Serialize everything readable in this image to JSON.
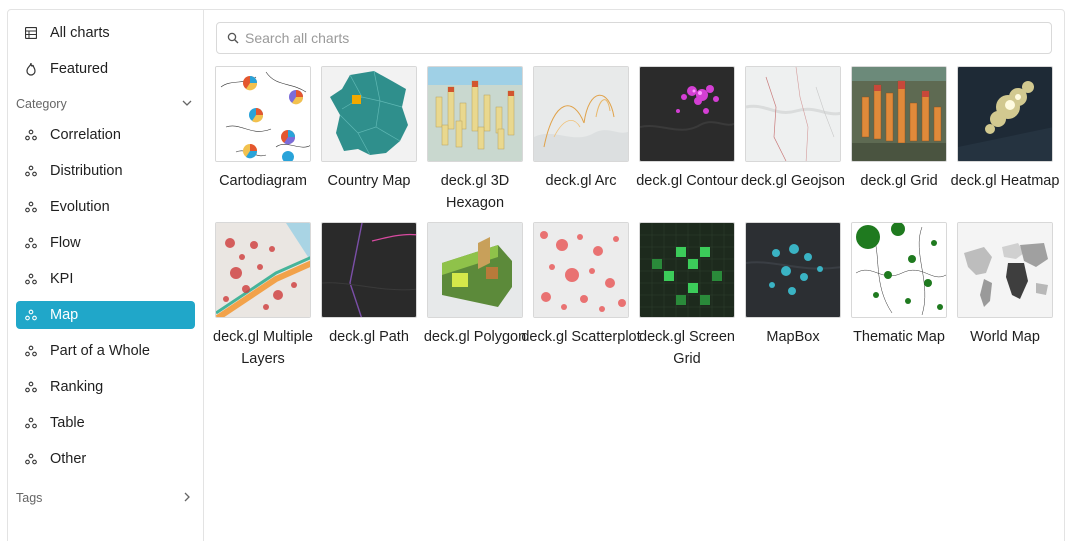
{
  "sidebar": {
    "all_charts": "All charts",
    "featured": "Featured",
    "category_header": "Category",
    "categories": [
      "Correlation",
      "Distribution",
      "Evolution",
      "Flow",
      "KPI",
      "Map",
      "Part of a Whole",
      "Ranking",
      "Table",
      "Other"
    ],
    "selected_category": "Map",
    "tags_header": "Tags"
  },
  "search": {
    "placeholder": "Search all charts",
    "value": ""
  },
  "charts": [
    {
      "label": "Cartodiagram",
      "thumb": "cartodiagram"
    },
    {
      "label": "Country Map",
      "thumb": "country-map"
    },
    {
      "label": "deck.gl 3D Hexagon",
      "thumb": "deckgl-3d-hexagon"
    },
    {
      "label": "deck.gl Arc",
      "thumb": "deckgl-arc"
    },
    {
      "label": "deck.gl Contour",
      "thumb": "deckgl-contour"
    },
    {
      "label": "deck.gl Geojson",
      "thumb": "deckgl-geojson"
    },
    {
      "label": "deck.gl Grid",
      "thumb": "deckgl-grid"
    },
    {
      "label": "deck.gl Heatmap",
      "thumb": "deckgl-heatmap"
    },
    {
      "label": "deck.gl Multiple Layers",
      "thumb": "deckgl-multiple-layers"
    },
    {
      "label": "deck.gl Path",
      "thumb": "deckgl-path"
    },
    {
      "label": "deck.gl Polygon",
      "thumb": "deckgl-polygon"
    },
    {
      "label": "deck.gl Scatterplot",
      "thumb": "deckgl-scatterplot"
    },
    {
      "label": "deck.gl Screen Grid",
      "thumb": "deckgl-screen-grid"
    },
    {
      "label": "MapBox",
      "thumb": "mapbox"
    },
    {
      "label": "Thematic Map",
      "thumb": "thematic-map"
    },
    {
      "label": "World Map",
      "thumb": "world-map"
    }
  ],
  "colors": {
    "accent": "#20a7c9",
    "border": "#e3e3e3"
  }
}
